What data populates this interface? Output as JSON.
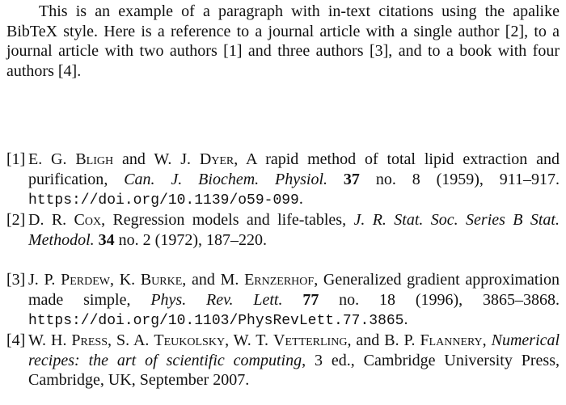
{
  "paragraph": {
    "text_1": "This is an example of a paragraph with in-text citations using the apalike BibTeX style. Here is a reference to a journal article with a single author ",
    "cite_1": "[2]",
    "text_2": ", to a journal article with two authors ",
    "cite_2": "[1]",
    "text_3": " and three authors ",
    "cite_3": "[3]",
    "text_4": ", and to a book with four authors ",
    "cite_4": "[4]",
    "text_5": "."
  },
  "references": [
    {
      "number": "[1]",
      "authors": [
        {
          "initials": "E. G.",
          "surname": "Bligh"
        },
        {
          "sep": " and "
        },
        {
          "initials": "W. J.",
          "surname": "Dyer"
        }
      ],
      "title": "A rapid method of total lipid extraction and purification",
      "journal": "Can. J. Biochem. Physiol.",
      "volume": "37",
      "details": "no. 8 (1959), 911–917.",
      "url": "https://doi.org/10.1139/o59-099",
      "end": "."
    },
    {
      "number": "[2]",
      "authors": [
        {
          "initials": "D. R.",
          "surname": "Cox"
        }
      ],
      "title": "Regression models and life-tables",
      "journal": "J. R. Stat. Soc. Series B Stat. Methodol.",
      "volume": "34",
      "details": "no. 2 (1972), 187–220."
    },
    {
      "number": "[3]",
      "authors": [
        {
          "initials": "J. P.",
          "surname": "Perdew"
        },
        {
          "sep": ", "
        },
        {
          "initials": "K.",
          "surname": "Burke"
        },
        {
          "sep": ", and "
        },
        {
          "initials": "M.",
          "surname": "Ernzerhof"
        }
      ],
      "title": "Generalized gradient approximation made simple",
      "journal": "Phys. Rev. Lett.",
      "volume": "77",
      "details": "no. 18 (1996), 3865–3868.",
      "url": "https://doi.org/10.1103/PhysRevLett.77.3865",
      "end": "."
    },
    {
      "number": "[4]",
      "authors": [
        {
          "initials": "W. H.",
          "surname": "Press"
        },
        {
          "sep": ", "
        },
        {
          "initials": "S. A.",
          "surname": "Teukolsky"
        },
        {
          "sep": ", "
        },
        {
          "initials": "W. T.",
          "surname": "Vetterling"
        },
        {
          "sep": ", and "
        },
        {
          "initials": "B. P.",
          "surname": "Flannery"
        }
      ],
      "title": "Numerical recipes: the art of scientific computing",
      "details": ", 3 ed., Cambridge University Press, Cambridge, UK, September 2007."
    }
  ]
}
